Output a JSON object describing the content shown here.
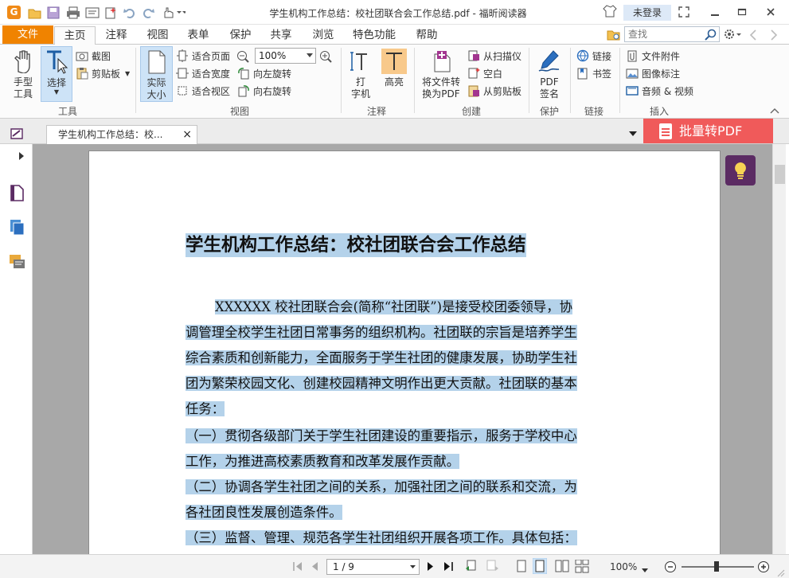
{
  "window": {
    "title": "学生机构工作总结：校社团联合会工作总结.pdf - 福昕阅读器",
    "login": "未登录",
    "logo_letter": "G"
  },
  "tabs": {
    "file": "文件",
    "items": [
      "主页",
      "注释",
      "视图",
      "表单",
      "保护",
      "共享",
      "浏览",
      "特色功能",
      "帮助"
    ],
    "search_placeholder": "查找"
  },
  "ribbon": {
    "tools": {
      "hand": [
        "手型",
        "工具"
      ],
      "select": "选择",
      "snapshot": "截图",
      "clipboard": "剪贴板",
      "group": "工具"
    },
    "view": {
      "actual_size": [
        "实际",
        "大小"
      ],
      "fit_page": "适合页面",
      "fit_width": "适合宽度",
      "fit_visible": "适合视区",
      "zoom": "100%",
      "rotate_left": "向左旋转",
      "rotate_right": "向右旋转",
      "group": "视图"
    },
    "annot": {
      "typewriter": [
        "打",
        "字机"
      ],
      "highlight": "高亮",
      "group": "注释"
    },
    "create": {
      "convert": [
        "将文件转",
        "换为PDF"
      ],
      "from_scanner": "从扫描仪",
      "blank": "空白",
      "from_clipboard": "从剪贴板",
      "group": "创建"
    },
    "protect": {
      "sign": [
        "PDF",
        "签名"
      ],
      "group": "保护"
    },
    "link": {
      "link": "链接",
      "bookmark": "书签",
      "group": "链接"
    },
    "insert": {
      "attachment": "文件附件",
      "image": "图像标注",
      "media": "音频 & 视频",
      "group": "插入"
    }
  },
  "doc_tab": {
    "label": "学生机构工作总结：校...",
    "close": "×"
  },
  "batch_button": "批量转PDF",
  "document": {
    "title": "学生机构工作总结：校社团联合会工作总结",
    "lines": [
      "XXXXXX 校社团联合会(简称“社团联”)是接受校团委领导，协",
      "调管理全校学生社团日常事务的组织机构。社团联的宗旨是培养学生",
      "综合素质和创新能力，全面服务于学生社团的健康发展，协助学生社",
      "团为繁荣校园文化、创建校园精神文明作出更大贡献。社团联的基本",
      "任务：",
      "（一）贯彻各级部门关于学生社团建设的重要指示，服务于学校中心",
      "工作，为推进高校素质教育和改革发展作贡献。",
      "（二）协调各学生社团之间的关系，加强社团之间的联系和交流，为",
      "各社团良性发展创造条件。",
      "（三）监督、管理、规范各学生社团组织开展各项工作。具体包括："
    ]
  },
  "status": {
    "page": "1 / 9",
    "zoom": "100%"
  },
  "colors": {
    "accent_orange": "#f08300",
    "highlight": "#b4d2ea",
    "batch_red": "#f05a5a",
    "bulb_purple": "#5b2b63"
  }
}
